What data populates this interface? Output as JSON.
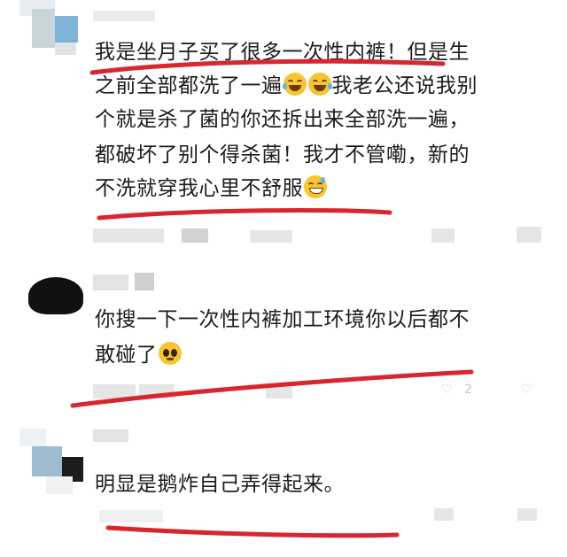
{
  "comments": [
    {
      "lines": [
        "我是坐月子买了很多一次性内裤！但是生",
        "之前全部都洗了一遍",
        "我老公还说我别",
        "个就是杀了菌的你还拆出来全部洗一遍，",
        "都破坏了别个得杀菌！我才不管嘞，新的",
        "不洗就穿我心里不舒服"
      ],
      "emoji_1": "rofl-emoji",
      "emoji_2": "rofl-emoji",
      "emoji_3": "grin-sweat-emoji"
    },
    {
      "lines": [
        "你搜一下一次性内裤加工环境你以后都不",
        "敢碰了"
      ],
      "emoji_1": "pleading-emoji",
      "like_count": "2"
    },
    {
      "lines": [
        "明显是鹅炸自己弄得起来。"
      ],
      "timestamp_partial": "1小时前"
    }
  ],
  "colors": {
    "underline": "#d8262e",
    "text": "#1b1b1b",
    "meta": "#bdbdbd"
  }
}
